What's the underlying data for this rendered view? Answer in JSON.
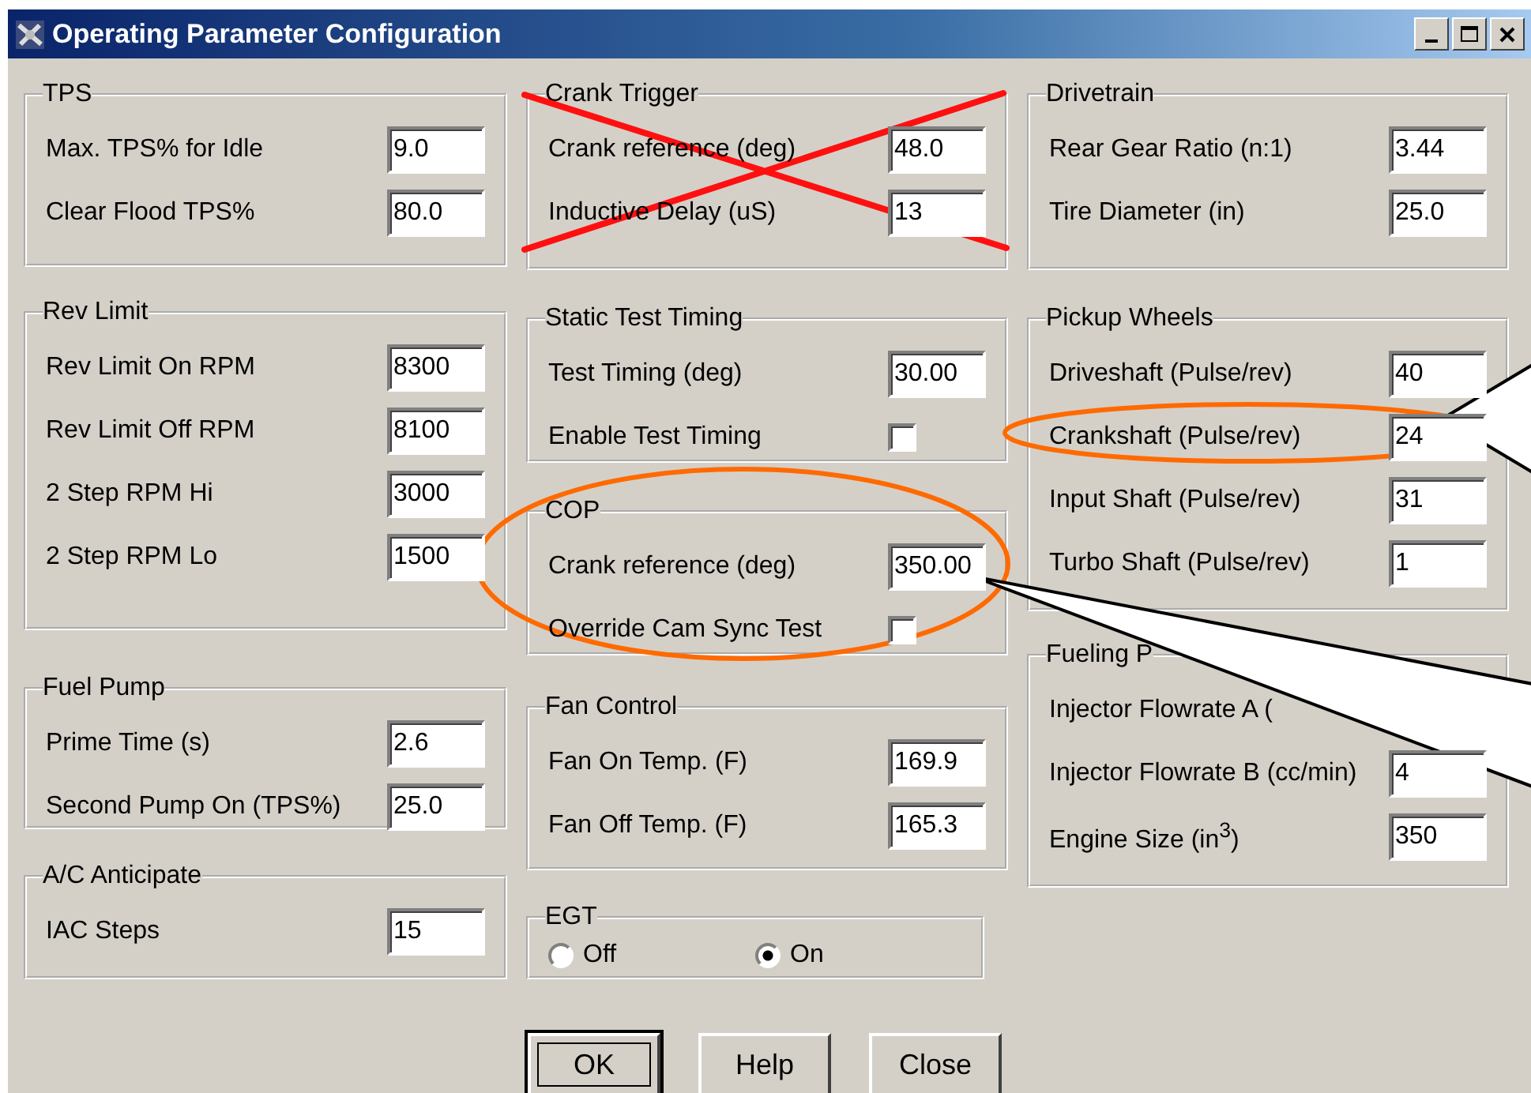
{
  "window": {
    "title": "Operating Parameter Configuration"
  },
  "columns": [
    {
      "groups": [
        {
          "title": "TPS",
          "kind": "fields",
          "rows": [
            {
              "kind": "field",
              "label": "Max. TPS% for Idle",
              "value": "9.0"
            },
            {
              "kind": "field",
              "label": "Clear Flood TPS%",
              "value": "80.0"
            }
          ]
        },
        {
          "title": "Rev Limit",
          "kind": "fields",
          "rows": [
            {
              "kind": "field",
              "label": "Rev Limit On RPM",
              "value": "8300"
            },
            {
              "kind": "field",
              "label": "Rev Limit Off RPM",
              "value": "8100"
            },
            {
              "kind": "field",
              "label": "2 Step RPM Hi",
              "value": "3000"
            },
            {
              "kind": "field",
              "label": "2 Step RPM Lo",
              "value": "1500"
            }
          ]
        },
        {
          "title": "Fuel Pump",
          "kind": "fields",
          "rows": [
            {
              "kind": "field",
              "label": "Prime Time (s)",
              "value": "2.6"
            },
            {
              "kind": "field",
              "label": "Second Pump On (TPS%)",
              "value": "25.0"
            }
          ]
        },
        {
          "title": "A/C Anticipate",
          "kind": "fields",
          "rows": [
            {
              "kind": "field",
              "label": "IAC Steps",
              "value": "15"
            }
          ]
        }
      ]
    },
    {
      "groups": [
        {
          "title": "Crank Trigger",
          "kind": "fields",
          "rows": [
            {
              "kind": "field",
              "label": "Crank reference (deg)",
              "value": "48.0"
            },
            {
              "kind": "field",
              "label": "Inductive Delay (uS)",
              "value": "13"
            }
          ]
        },
        {
          "title": "Static Test Timing",
          "kind": "fields",
          "rows": [
            {
              "kind": "field",
              "label": "Test Timing (deg)",
              "value": "30.00"
            },
            {
              "kind": "checkbox",
              "label": "Enable Test Timing",
              "checked": false
            }
          ]
        },
        {
          "title": "COP",
          "kind": "fields",
          "rows": [
            {
              "kind": "field",
              "label": "Crank reference (deg)",
              "value": "350.00"
            },
            {
              "kind": "checkbox",
              "label": "Override Cam Sync Test",
              "checked": false
            }
          ]
        },
        {
          "title": "Fan Control",
          "kind": "fields",
          "rows": [
            {
              "kind": "field",
              "label": "Fan On Temp. (F)",
              "value": "169.9"
            },
            {
              "kind": "field",
              "label": "Fan Off Temp. (F)",
              "value": "165.3"
            }
          ]
        },
        {
          "title": "EGT",
          "kind": "radio",
          "rows": [
            {
              "kind": "radio",
              "label": "Off",
              "selected": false
            },
            {
              "kind": "radio",
              "label": "On",
              "selected": true
            }
          ]
        }
      ]
    },
    {
      "groups": [
        {
          "title": "Drivetrain",
          "kind": "fields",
          "rows": [
            {
              "kind": "field",
              "label": "Rear Gear Ratio (n:1)",
              "value": "3.44"
            },
            {
              "kind": "field",
              "label": "Tire Diameter (in)",
              "value": "25.0"
            }
          ]
        },
        {
          "title": "Pickup Wheels",
          "kind": "fields",
          "rows": [
            {
              "kind": "field",
              "label": "Driveshaft (Pulse/rev)",
              "value": "40"
            },
            {
              "kind": "field",
              "label": "Crankshaft (Pulse/rev)",
              "value": "24"
            },
            {
              "kind": "field",
              "label": "Input Shaft (Pulse/rev)",
              "value": "31"
            },
            {
              "kind": "field",
              "label": "Turbo Shaft (Pulse/rev)",
              "value": "1"
            }
          ]
        },
        {
          "title": "Fueling P",
          "kind": "fields",
          "rows": [
            {
              "kind": "label",
              "label": "Injector Flowrate A ("
            },
            {
              "kind": "field",
              "label": "Injector Flowrate B (cc/min)",
              "value": "4"
            },
            {
              "kind": "field",
              "label": "Engine Size (in$^{3}$)",
              "value": "350"
            }
          ]
        }
      ]
    }
  ],
  "buttons": [
    {
      "label": "OK",
      "focused": true
    },
    {
      "label": "Help",
      "focused": false
    },
    {
      "label": "Close",
      "focused": false
    }
  ]
}
